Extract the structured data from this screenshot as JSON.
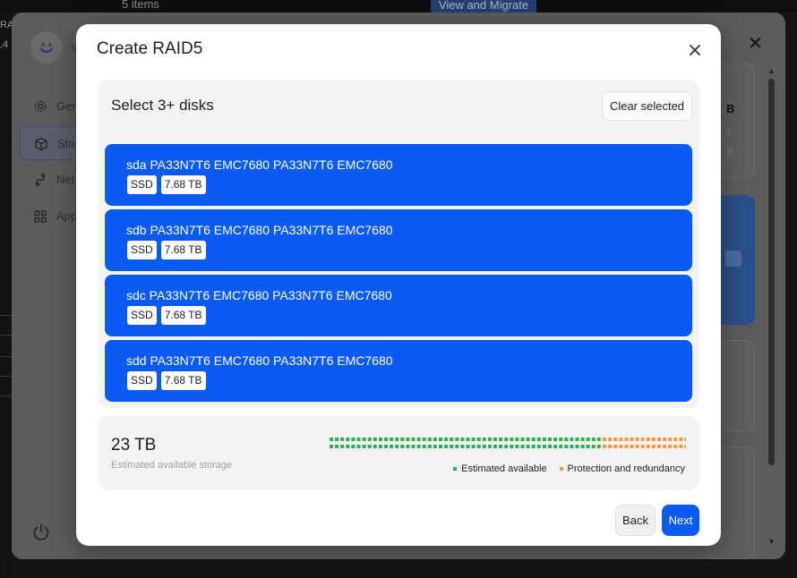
{
  "background": {
    "top_item_count": "5 items",
    "top_button": "View and Migrate",
    "edge_text_1": "RA",
    "edge_text_2": ",4",
    "avatar_name": "v",
    "nav": [
      {
        "label": "Gen",
        "icon": "gear-icon"
      },
      {
        "label": "Sto",
        "icon": "cube-icon"
      },
      {
        "label": "Net",
        "icon": "network-icon"
      },
      {
        "label": "App",
        "icon": "apps-grid-icon"
      }
    ],
    "card_b": "B",
    "card_b_sub": "B"
  },
  "modal": {
    "title": "Create RAID5",
    "select_heading": "Select 3+ disks",
    "clear_label": "Clear selected",
    "disks": [
      {
        "name": "sda PA33N7T6 EMC7680 PA33N7T6 EMC7680",
        "type": "SSD",
        "size": "7.68 TB"
      },
      {
        "name": "sdb PA33N7T6 EMC7680 PA33N7T6 EMC7680",
        "type": "SSD",
        "size": "7.68 TB"
      },
      {
        "name": "sdc PA33N7T6 EMC7680 PA33N7T6 EMC7680",
        "type": "SSD",
        "size": "7.68 TB"
      },
      {
        "name": "sdd PA33N7T6 EMC7680 PA33N7T6 EMC7680",
        "type": "SSD",
        "size": "7.68 TB"
      }
    ],
    "storage_value": "23 TB",
    "storage_caption": "Estimated available storage",
    "capacity_bar": {
      "available_fraction": 0.75,
      "protection_fraction": 0.25
    },
    "legend_available": "Estimated available",
    "legend_protection": "Protection and redundancy",
    "back_label": "Back",
    "next_label": "Next"
  },
  "colors": {
    "accent": "#0a5bf5",
    "available": "#2bb24c",
    "protection": "#f29a3e"
  }
}
